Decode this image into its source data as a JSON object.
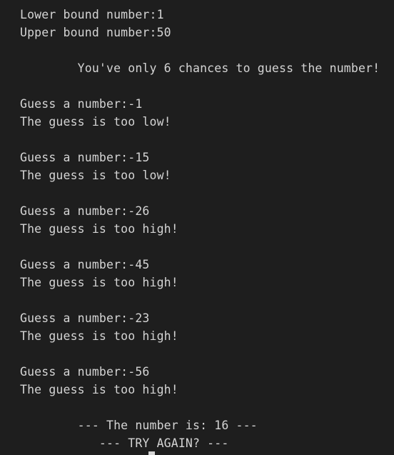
{
  "terminal": {
    "lower_bound": "Lower bound number:1",
    "upper_bound": "Upper bound number:50",
    "chances": "        You've only 6 chances to guess the number!",
    "guesses": [
      {
        "prompt": "Guess a number:-1",
        "result": "The guess is too low!"
      },
      {
        "prompt": "Guess a number:-15",
        "result": "The guess is too low!"
      },
      {
        "prompt": "Guess a number:-26",
        "result": "The guess is too high!"
      },
      {
        "prompt": "Guess a number:-45",
        "result": "The guess is too high!"
      },
      {
        "prompt": "Guess a number:-23",
        "result": "The guess is too high!"
      },
      {
        "prompt": "Guess a number:-56",
        "result": "The guess is too high!"
      }
    ],
    "answer": "        --- The number is: 16 ---",
    "try_again": "           --- TRY AGAIN? ---"
  }
}
